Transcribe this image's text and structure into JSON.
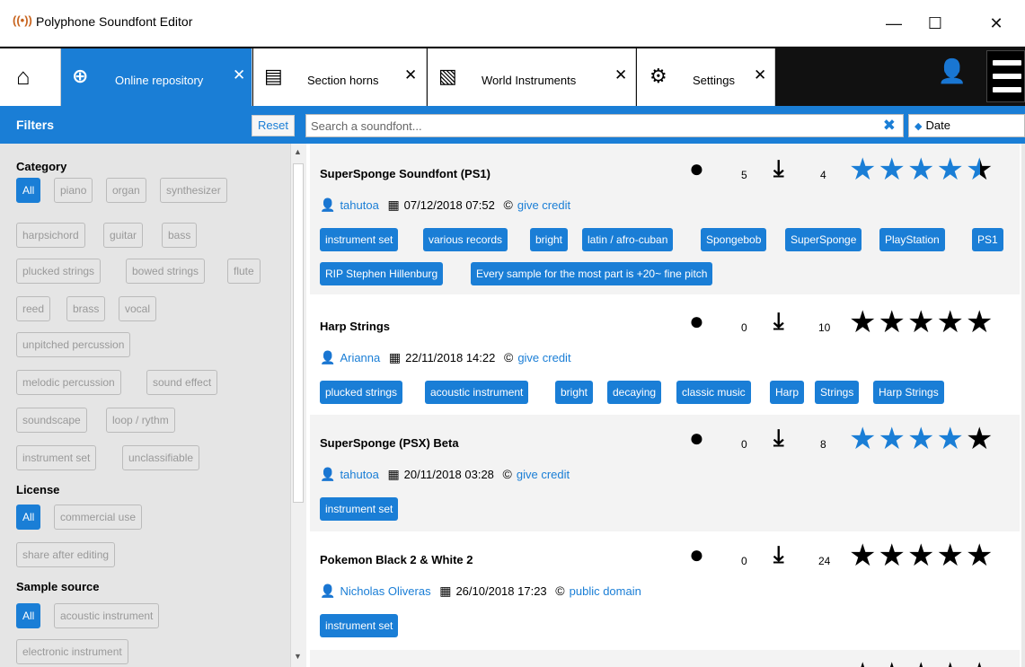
{
  "window": {
    "title": "Polyphone Soundfont Editor",
    "app_icon": "antenna-icon",
    "minimize": "—",
    "maximize": "☐",
    "close": "✕"
  },
  "tabs": [
    {
      "label": "",
      "icon": "home-icon",
      "glyph": "⌂"
    },
    {
      "label": "Online repository",
      "icon": "globe-icon",
      "glyph": "⊕",
      "close": "✕",
      "active": true
    },
    {
      "label": "Section horns",
      "icon": "document-icon",
      "glyph": "▤",
      "close": "✕"
    },
    {
      "label": "World Instruments",
      "icon": "sound-file-icon",
      "glyph": "▧",
      "close": "✕"
    },
    {
      "label": "Settings",
      "icon": "gears-icon",
      "glyph": "⚙",
      "close": "✕"
    }
  ],
  "toolbar": {
    "user_glyph": "👤",
    "user_icon": "user-icon",
    "menu_icon": "menu-icon"
  },
  "filterbar": {
    "title": "Filters",
    "reset_label": "Reset",
    "search_placeholder": "Search a soundfont...",
    "search_value": "",
    "clear_glyph": "✖",
    "sort_arrows": "◆",
    "sort_value": "Date"
  },
  "sidebar": {
    "category_title": "Category",
    "category_items": [
      "All",
      "piano",
      "organ",
      "synthesizer",
      "harpsichord",
      "guitar",
      "bass",
      "plucked strings",
      "bowed strings",
      "flute",
      "reed",
      "brass",
      "vocal",
      "unpitched percussion",
      "melodic percussion",
      "sound effect",
      "soundscape",
      "loop / rythm",
      "instrument set",
      "unclassifiable"
    ],
    "license_title": "License",
    "license_items": [
      "All",
      "commercial use",
      "share after editing"
    ],
    "sample_title": "Sample source",
    "sample_items": [
      "All",
      "acoustic instrument",
      "electronic instrument"
    ],
    "scroll_up": "▲",
    "scroll_down": "▼"
  },
  "soundfonts": [
    {
      "name": "SuperSponge Soundfont (PS1)",
      "comments": "5",
      "downloads": "4",
      "rating": 4.5,
      "author": "tahutoa",
      "date": "07/12/2018 07:52",
      "license": "give credit",
      "tags": [
        "instrument set",
        "various records",
        "bright",
        "latin / afro-cuban",
        "Spongebob",
        "SuperSponge",
        "PlayStation",
        "PS1",
        "RIP Stephen Hillenburg",
        "Every sample for the most part is +20~ fine pitch"
      ]
    },
    {
      "name": "Harp Strings",
      "comments": "0",
      "downloads": "10",
      "rating": 0,
      "author": "Arianna",
      "date": "22/11/2018 14:22",
      "license": "give credit",
      "tags": [
        "plucked strings",
        "acoustic instrument",
        "bright",
        "decaying",
        "classic music",
        "Harp",
        "Strings",
        "Harp Strings"
      ]
    },
    {
      "name": "SuperSponge (PSX) Beta",
      "comments": "0",
      "downloads": "8",
      "rating": 4,
      "author": "tahutoa",
      "date": "20/11/2018 03:28",
      "license": "give credit",
      "tags": [
        "instrument set"
      ]
    },
    {
      "name": "Pokemon Black 2 & White 2",
      "comments": "0",
      "downloads": "24",
      "rating": 0,
      "author": "Nicholas Oliveras",
      "date": "26/10/2018 17:23",
      "license": "public domain",
      "tags": [
        "instrument set"
      ]
    }
  ],
  "glyphs": {
    "comment": "●",
    "download": "⤓",
    "star": "★",
    "user": "👤",
    "calendar": "▦",
    "license": "©"
  },
  "colors": {
    "accent": "#1a7ed6",
    "tabbar": "#111111",
    "sidebar": "#e5e5e5"
  }
}
